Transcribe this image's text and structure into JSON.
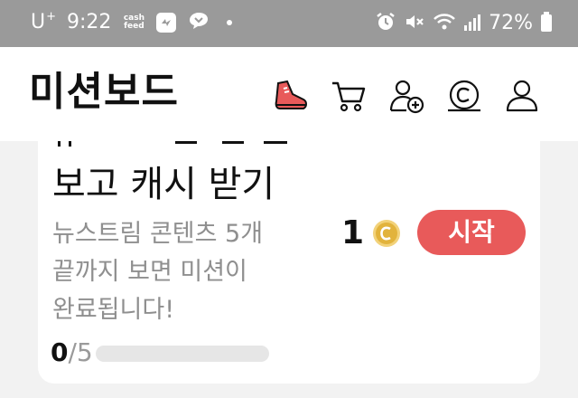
{
  "status_bar": {
    "carrier": "U",
    "carrier_sup": "+",
    "time": "9:22",
    "cashfeed_logo_top": "cash",
    "cashfeed_logo_bottom": "feed",
    "battery": "72%",
    "icons": [
      "alarm-icon",
      "mute-icon",
      "wifi-icon",
      "signal-icon",
      "battery-icon"
    ]
  },
  "header": {
    "title": "미션보드",
    "icons": [
      "shoe-icon",
      "cart-icon",
      "add-friend-icon",
      "cash-coin-icon",
      "profile-icon"
    ]
  },
  "mission": {
    "title": "보고 캐시 받기",
    "description_lines": [
      "뉴스트림 콘텐츠 5개",
      "끝까지 보면 미션이",
      "완료됩니다!"
    ],
    "reward": "1",
    "reward_icon": "cash-coin-icon",
    "start_label": "시작",
    "progress_current": "0",
    "progress_total": "/5",
    "progress_fraction": 0
  },
  "colors": {
    "accent": "#e85a5a",
    "status_bar": "#9a9a9a",
    "coin": "#e2b33c"
  }
}
